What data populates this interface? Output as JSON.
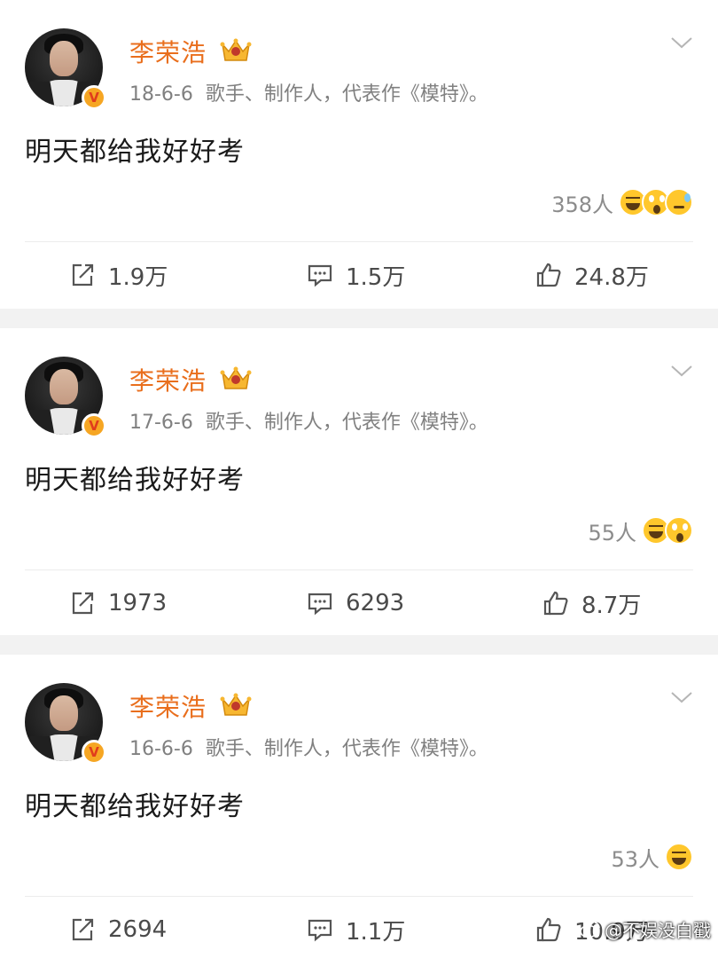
{
  "posts": [
    {
      "author": "李荣浩",
      "date": "18-6-6",
      "bio": "歌手、制作人，代表作《模特》。",
      "text": "明天都给我好好考",
      "reaction_count": "358人",
      "reactions": [
        "grin-emoji",
        "shocked-emoji",
        "sweat-emoji"
      ],
      "reposts": "1.9万",
      "comments": "1.5万",
      "likes": "24.8万"
    },
    {
      "author": "李荣浩",
      "date": "17-6-6",
      "bio": "歌手、制作人，代表作《模特》。",
      "text": "明天都给我好好考",
      "reaction_count": "55人",
      "reactions": [
        "grin-emoji",
        "shocked-emoji"
      ],
      "reposts": "1973",
      "comments": "6293",
      "likes": "8.7万"
    },
    {
      "author": "李荣浩",
      "date": "16-6-6",
      "bio": "歌手、制作人，代表作《模特》。",
      "text": "明天都给我好好考",
      "reaction_count": "53人",
      "reactions": [
        "grin-emoji"
      ],
      "reposts": "2694",
      "comments": "1.1万",
      "likes": "10.9万"
    }
  ],
  "verified_badge": "V",
  "watermark": "@不娱没白戳",
  "colors": {
    "name": "#e96e1c",
    "meta": "#808080",
    "text": "#1a1a1a",
    "badge": "#f6a623",
    "separator": "#f2f2f2"
  }
}
